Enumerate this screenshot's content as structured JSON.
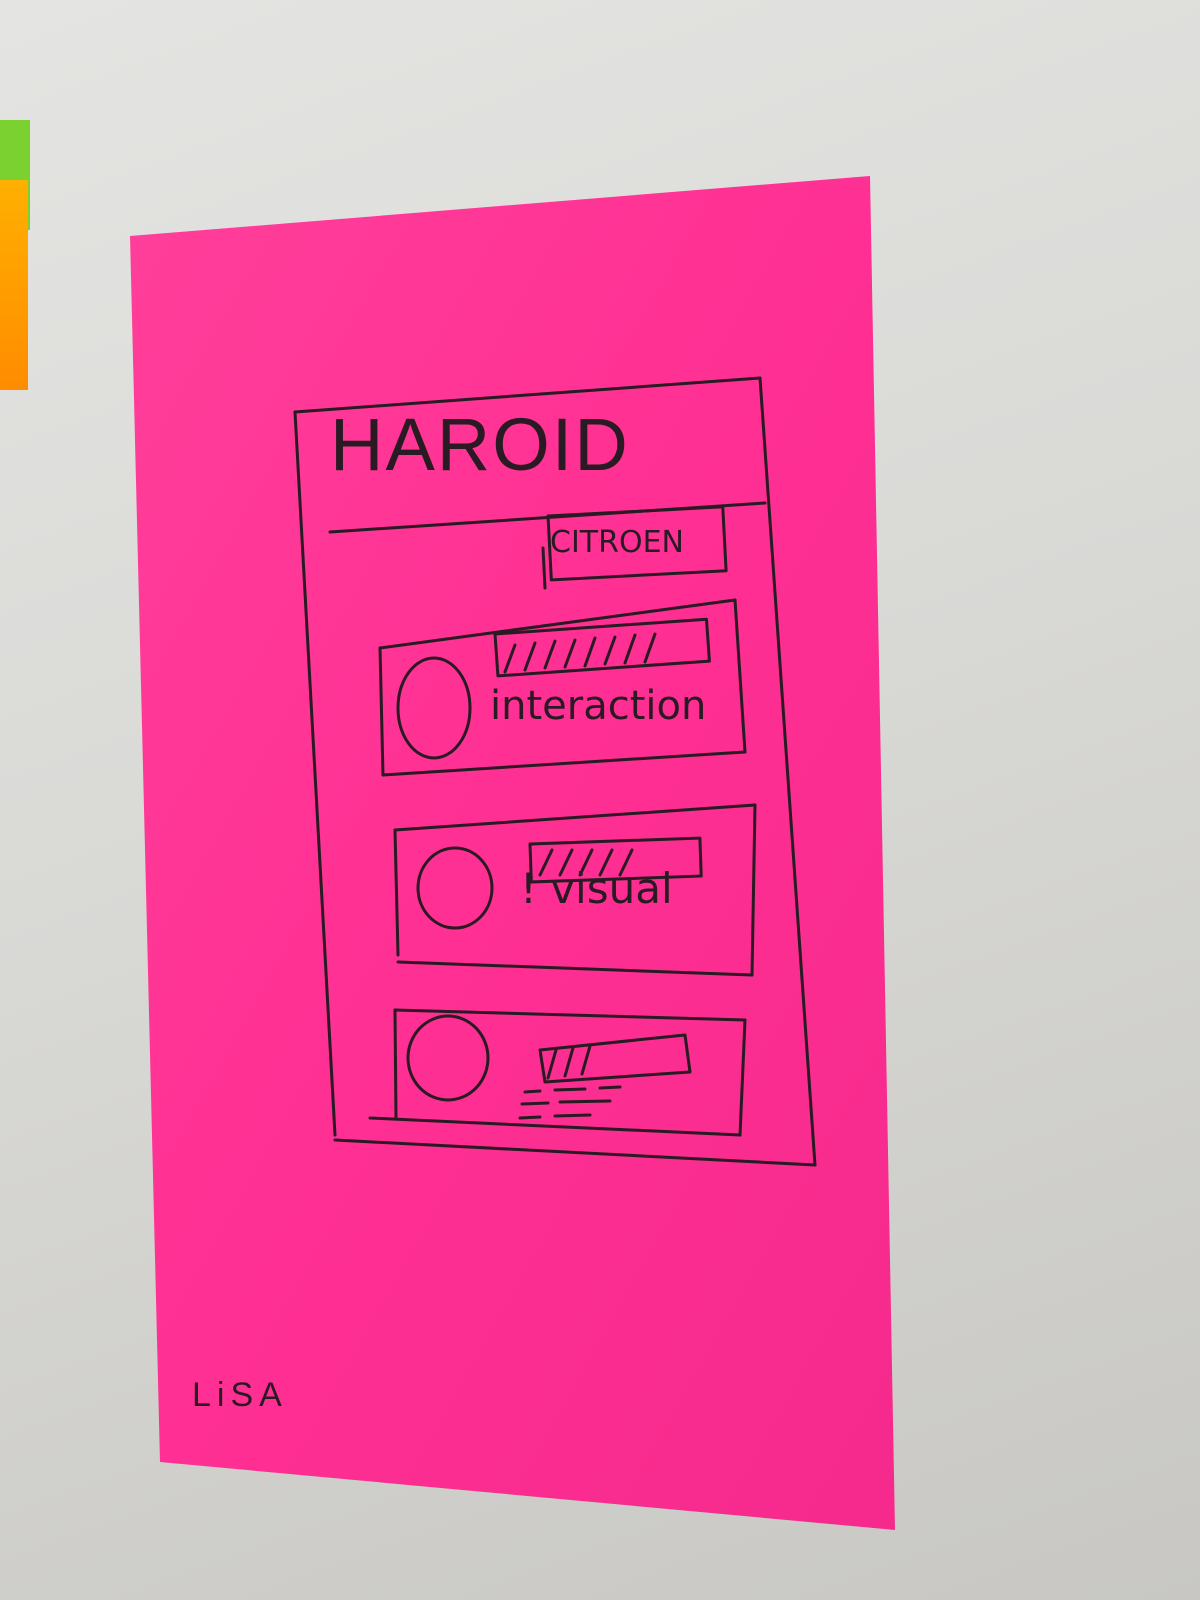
{
  "app": {
    "title": "HAROID"
  },
  "header": {
    "button_label": "CITROEN"
  },
  "cards": [
    {
      "label": "interaction",
      "progress": 0.72
    },
    {
      "label": "! visual",
      "progress": 0.55
    },
    {
      "label": "",
      "progress": 0.3
    }
  ],
  "signature": "LiSA",
  "colors": {
    "sticky_note": "#ff2f93",
    "ink": "#2a1a24",
    "wall": "#dcdcda",
    "side_green": "#7bd12f",
    "side_orange": "#ff9a00"
  }
}
